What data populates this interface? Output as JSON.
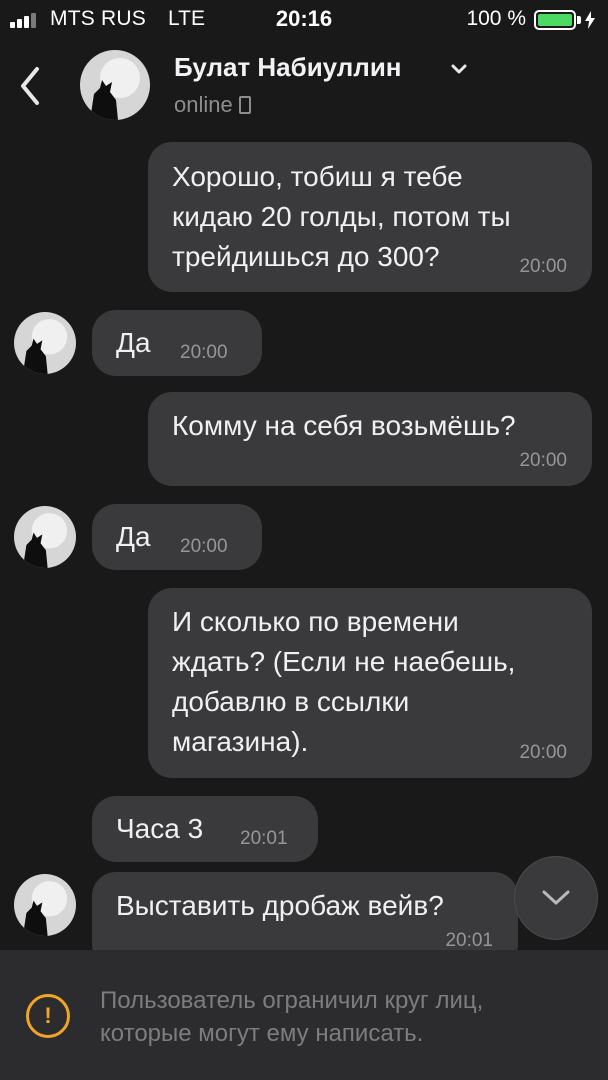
{
  "status_bar": {
    "carrier": "MTS RUS",
    "network": "LTE",
    "time": "20:16",
    "battery_percent": "100 %",
    "battery_color": "#4cd964"
  },
  "header": {
    "contact_name": "Булат Набиуллин",
    "status": "online",
    "back_icon": "chevron-left-icon",
    "menu_icon": "chevron-down-icon",
    "device_icon": "phone-icon"
  },
  "messages": [
    {
      "direction": "outgoing",
      "text": "Хорошо, тобиш я тебе\nкидаю 20 голды, потом ты\nтрейдишься до 300?",
      "time": "20:00"
    },
    {
      "direction": "incoming",
      "text": "Да",
      "time": "20:00"
    },
    {
      "direction": "outgoing",
      "text": "Комму на себя возьмёшь?",
      "time": "20:00"
    },
    {
      "direction": "incoming",
      "text": "Да",
      "time": "20:00"
    },
    {
      "direction": "outgoing",
      "text": "И сколько по времени\nждать? (Если не наебешь,\nдобавлю в ссылки\nмагазина).",
      "time": "20:00"
    },
    {
      "direction": "incoming",
      "text": "Часа 3",
      "time": "20:01"
    },
    {
      "direction": "incoming",
      "text": "Выставить дробаж вейв?",
      "time": "20:01"
    }
  ],
  "scroll_down_icon": "chevron-down-icon",
  "restriction": {
    "icon": "warning-icon",
    "text": "Пользователь ограничил круг лиц, которые могут ему написать.",
    "accent_color": "#f0a529"
  }
}
